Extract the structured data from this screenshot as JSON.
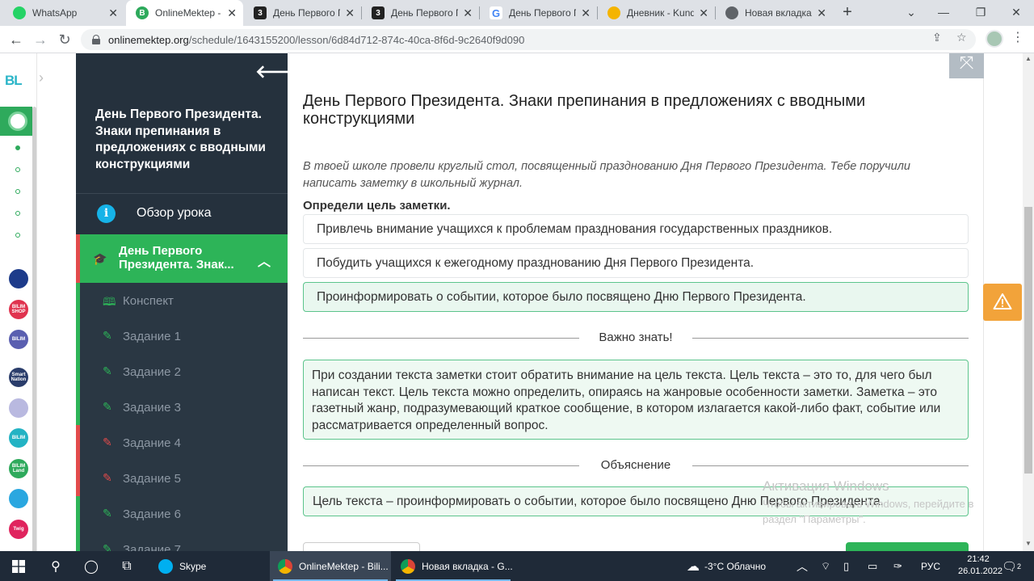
{
  "browser": {
    "tabs": [
      {
        "title": "WhatsApp",
        "icon": "whatsapp-icon",
        "color": "#25d366",
        "letter": "",
        "active": false
      },
      {
        "title": "OnlineMektep - E",
        "icon": "bilimland-icon",
        "color": "#2eaa5c",
        "letter": "B",
        "active": true
      },
      {
        "title": "День Первого П",
        "icon": "doc-3-icon",
        "color": "#222222",
        "letter": "3",
        "active": false
      },
      {
        "title": "День Первого П",
        "icon": "doc-3-icon",
        "color": "#222222",
        "letter": "3",
        "active": false
      },
      {
        "title": "День Первого П",
        "icon": "google-icon",
        "color": "#4285f4",
        "letter": "G",
        "active": false
      },
      {
        "title": "Дневник - Kundé",
        "icon": "kundelik-icon",
        "color": "#f4b400",
        "letter": "",
        "active": false
      },
      {
        "title": "Новая вкладка",
        "icon": "chrome-icon",
        "color": "#5f6368",
        "letter": "",
        "active": false
      }
    ],
    "url_host": "onlinemektep.org",
    "url_path": "/schedule/1643155200/lesson/6d84d712-874c-40ca-8f6d-9c2640f9d090"
  },
  "rail": {
    "logo": "BL",
    "apps": [
      {
        "label": "",
        "color": "#1d3b8a"
      },
      {
        "label": "BILIM SHOP",
        "color": "#e0334f"
      },
      {
        "label": "BILIM",
        "color": "#5a5fb0"
      },
      {
        "label": "Smart Nation",
        "color": "#2a3d6b"
      },
      {
        "label": "",
        "color": "#b9b9e0"
      },
      {
        "label": "BILIM",
        "color": "#23b3c4"
      },
      {
        "label": "BILIM Land",
        "color": "#2eaa5c"
      },
      {
        "label": "",
        "color": "#2aa7e0"
      },
      {
        "label": "Twig",
        "color": "#e0245e"
      }
    ]
  },
  "sidebar": {
    "lesson_title": "День Первого Президента. Знаки препинания в предложениях с вводными конструкциями",
    "overview": "Обзор урока",
    "topic": "День Первого Президента. Знак...",
    "items": [
      {
        "label": "Конспект",
        "icon": "book-icon",
        "status": "done"
      },
      {
        "label": "Задание 1",
        "icon": "edit-icon",
        "status": "done"
      },
      {
        "label": "Задание 2",
        "icon": "edit-icon",
        "status": "done"
      },
      {
        "label": "Задание 3",
        "icon": "edit-icon",
        "status": "done"
      },
      {
        "label": "Задание 4",
        "icon": "edit-icon",
        "status": "wrong"
      },
      {
        "label": "Задание 5",
        "icon": "edit-icon",
        "status": "wrong"
      },
      {
        "label": "Задание 6",
        "icon": "edit-icon",
        "status": "done"
      },
      {
        "label": "Задание 7",
        "icon": "edit-icon",
        "status": "done"
      }
    ]
  },
  "main": {
    "title": "День Первого Президента. Знаки препинания в предложениях с вводными конструкциями",
    "intro": "В твоей школе провели круглый стол, посвященный празднованию Дня Первого Президента. Тебе поручили написать заметку в школьный журнал.",
    "question": "Определи цель заметки.",
    "options": [
      {
        "text": "Привлечь внимание учащихся к проблемам празднования государственных праздников.",
        "correct": false
      },
      {
        "text": "Побудить учащихся к ежегодному празднованию Дня Первого Президента.",
        "correct": false
      },
      {
        "text": "Проинформировать о событии, которое было посвящено Дню Первого Президента.",
        "correct": true
      }
    ],
    "important_label": "Важно знать!",
    "important_text": "При создании текста заметки стоит обратить внимание на цель текста. Цель текста – это то, для чего был написан текст. Цель текста можно определить, опираясь на жанровые особенности заметки. Заметка – это газетный жанр, подразумевающий краткое сообщение, в котором излагается какой-либо факт, событие или рассматривается определенный вопрос.",
    "explanation_label": "Объяснение",
    "explanation_text": "Цель текста – проинформировать о событии, которое было посвящено Дню Первого Президента."
  },
  "watermark": {
    "title": "Активация Windows",
    "text": "Чтобы активировать Windows, перейдите в раздел \"Параметры\"."
  },
  "taskbar": {
    "apps": [
      {
        "label": "Skype",
        "color": "#00aff0",
        "active": false
      },
      {
        "label": "OnlineMektep - Bili...",
        "color": "#dd5144",
        "active": true
      },
      {
        "label": "Новая вкладка - G...",
        "color": "#dd5144",
        "active": false
      }
    ],
    "weather": "-3°C  Облачно",
    "lang": "РУС",
    "time": "21:42",
    "date": "26.01.2022",
    "notifications": "2"
  },
  "colors": {
    "accent_green": "#2db458",
    "sidebar_bg": "#25313d",
    "wrong_red": "#e24b4b",
    "warning_orange": "#f2a33a"
  }
}
